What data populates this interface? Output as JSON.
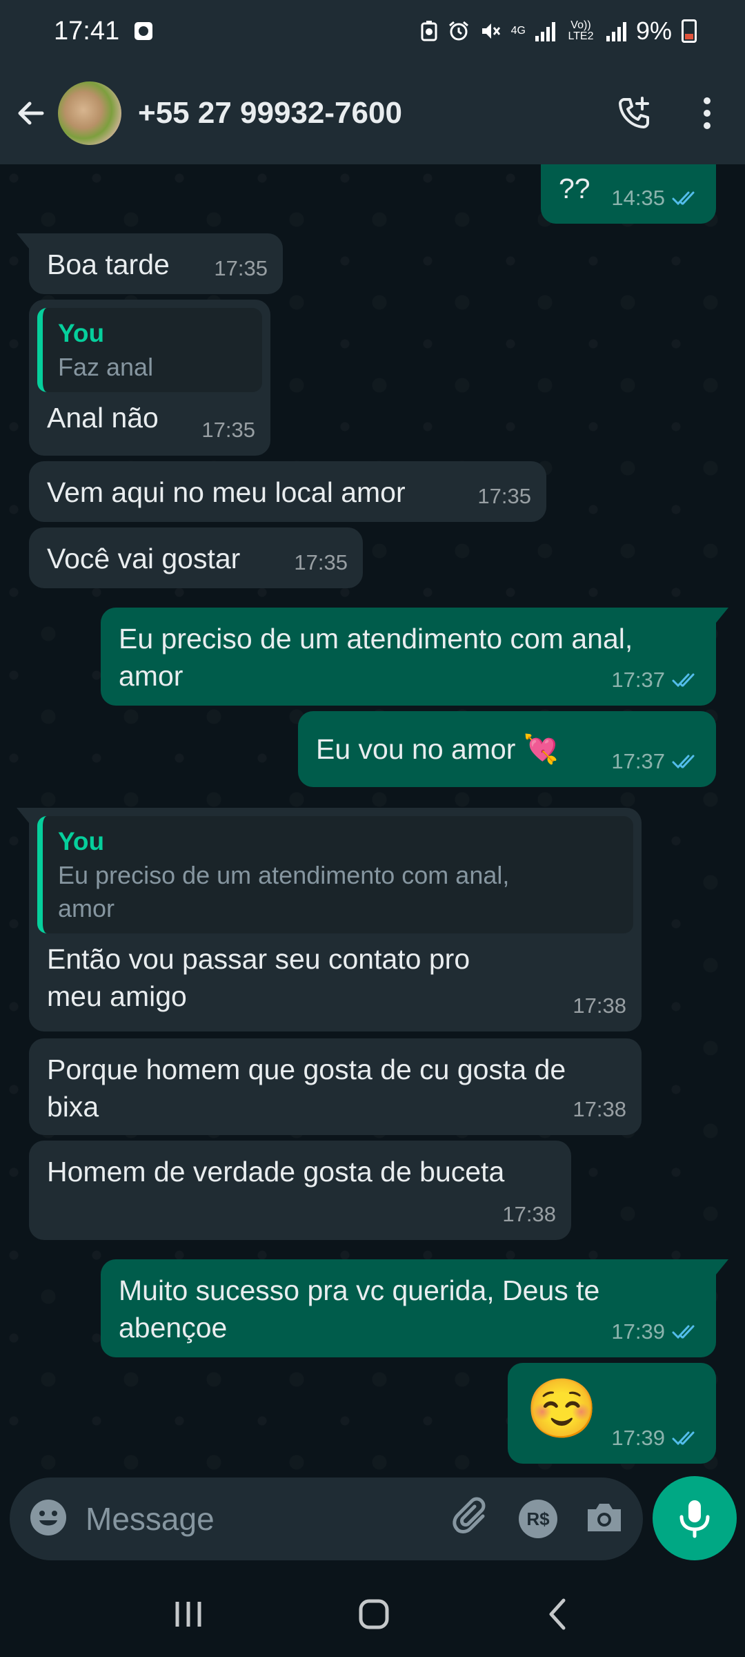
{
  "status_bar": {
    "time": "17:41",
    "network_4g": "4G",
    "volte": "Vo)) LTE2",
    "battery": "9%"
  },
  "header": {
    "contact_name": "+55 27 99932-7600",
    "icons": [
      "back-arrow-icon",
      "avatar",
      "add-call-icon",
      "more-vert-icon"
    ]
  },
  "colors": {
    "incoming_bubble": "#202c33",
    "outgoing_bubble": "#005c4b",
    "accent": "#00a884",
    "quote_author": "#06cf9c",
    "ticks_read": "#53bdeb"
  },
  "messages": [
    {
      "dir": "out",
      "text": "??",
      "time": "14:35"
    },
    {
      "dir": "in",
      "text": "Boa tarde",
      "time": "17:35"
    },
    {
      "dir": "in",
      "quote_author": "You",
      "quote_text": "Faz anal",
      "text": "Anal não",
      "time": "17:35"
    },
    {
      "dir": "in",
      "text": "Vem aqui no meu local amor",
      "time": "17:35"
    },
    {
      "dir": "in",
      "text": "Você vai gostar",
      "time": "17:35"
    },
    {
      "dir": "out",
      "text": "Eu preciso de um atendimento com anal, amor",
      "time": "17:37"
    },
    {
      "dir": "out",
      "text": "Eu vou no amor 💘",
      "time": "17:37"
    },
    {
      "dir": "in",
      "quote_author": "You",
      "quote_text": "Eu preciso de um atendimento com anal, amor",
      "text": "Então vou passar seu contato pro meu amigo",
      "time": "17:38"
    },
    {
      "dir": "in",
      "text": "Porque homem que gosta de cu gosta de bixa",
      "time": "17:38"
    },
    {
      "dir": "in",
      "text": "Homem de verdade gosta de buceta",
      "time": "17:38"
    },
    {
      "dir": "out",
      "text": "Muito sucesso pra vc querida, Deus te abençoe",
      "time": "17:39"
    },
    {
      "dir": "out",
      "text": "☺️",
      "time": "17:39"
    }
  ],
  "input_bar": {
    "placeholder": "Message",
    "icons": [
      "emoji-icon",
      "attach-icon",
      "payment-icon",
      "camera-icon",
      "mic-icon"
    ],
    "payment_label": "R$"
  },
  "nav_bar": {
    "icons": [
      "recents-icon",
      "home-icon",
      "back-icon"
    ]
  }
}
